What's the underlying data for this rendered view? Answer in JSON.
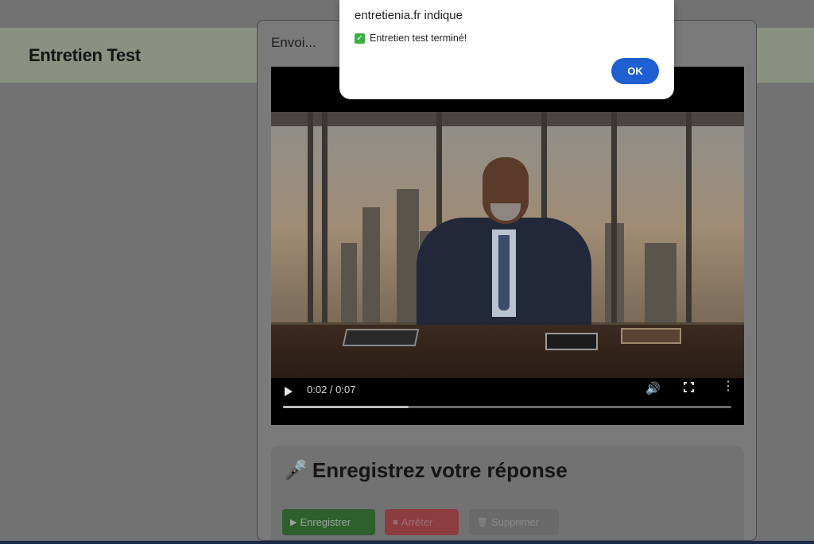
{
  "page": {
    "title": "Entretien Test"
  },
  "modal": {
    "title": "Envoi...",
    "video": {
      "time": "0:02 / 0:07",
      "progress": 0.28
    },
    "record": {
      "title": "Enregistrez votre réponse",
      "mic_icon": "🎤",
      "buttons": {
        "record": "Enregistrer",
        "stop": "Arrêter",
        "delete": "Supprimer"
      }
    }
  },
  "alert": {
    "title": "entretienia.fr indique",
    "message": "Entretien test terminé!",
    "ok": "OK"
  },
  "colors": {
    "ok_button": "#1f5fd1",
    "record_button": "#2e5f2c",
    "stop_button": "#8c3d40"
  }
}
